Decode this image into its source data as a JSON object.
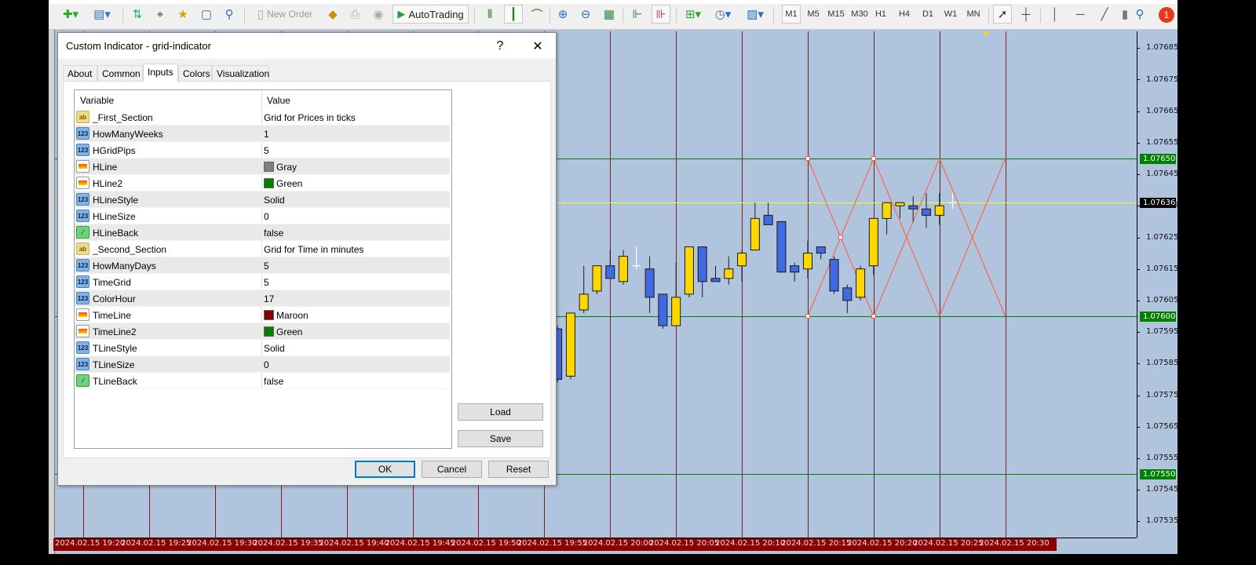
{
  "toolbar": {
    "new_order_label": "New Order",
    "autotrading_label": "AutoTrading",
    "timeframes": [
      "M1",
      "M5",
      "M15",
      "M30",
      "H1",
      "H4",
      "D1",
      "W1",
      "MN"
    ],
    "active_timeframe": "M1",
    "notification_count": "1"
  },
  "dialog": {
    "title": "Custom Indicator - grid-indicator",
    "help_label": "?",
    "close_label": "✕",
    "tabs": [
      "About",
      "Common",
      "Inputs",
      "Colors",
      "Visualization"
    ],
    "active_tab": "Inputs",
    "columns": {
      "variable": "Variable",
      "value": "Value"
    },
    "inputs": [
      {
        "type": "str",
        "name": "_First_Section",
        "value": "Grid for Prices in ticks"
      },
      {
        "type": "int",
        "name": "HowManyWeeks",
        "value": "1"
      },
      {
        "type": "int",
        "name": "HGridPips",
        "value": "5"
      },
      {
        "type": "color",
        "name": "HLine",
        "value": "Gray",
        "swatch": "#808080"
      },
      {
        "type": "color",
        "name": "HLine2",
        "value": "Green",
        "swatch": "#008000"
      },
      {
        "type": "int",
        "name": "HLineStyle",
        "value": "Solid"
      },
      {
        "type": "int",
        "name": "HLineSize",
        "value": "0"
      },
      {
        "type": "bool",
        "name": "HLineBack",
        "value": "false"
      },
      {
        "type": "str",
        "name": "_Second_Section",
        "value": "Grid for Time in minutes"
      },
      {
        "type": "int",
        "name": "HowManyDays",
        "value": "5"
      },
      {
        "type": "int",
        "name": "TimeGrid",
        "value": "5"
      },
      {
        "type": "int",
        "name": "ColorHour",
        "value": "17"
      },
      {
        "type": "color",
        "name": "TimeLine",
        "value": "Maroon",
        "swatch": "#800000"
      },
      {
        "type": "color",
        "name": "TimeLine2",
        "value": "Green",
        "swatch": "#008000"
      },
      {
        "type": "int",
        "name": "TLineStyle",
        "value": "Solid"
      },
      {
        "type": "int",
        "name": "TLineSize",
        "value": "0"
      },
      {
        "type": "bool",
        "name": "TLineBack",
        "value": "false"
      }
    ],
    "load_label": "Load",
    "save_label": "Save",
    "ok_label": "OK",
    "cancel_label": "Cancel",
    "reset_label": "Reset"
  },
  "chart_data": {
    "type": "candlestick",
    "date": "2024.02.15",
    "background": "#b0c4de",
    "bull_color": "#ffd700",
    "bear_color": "#4169e1",
    "time_labels": [
      "2024.02.15 19:20",
      "2024.02.15 19:25",
      "2024.02.15 19:30",
      "2024.02.15 19:35",
      "2024.02.15 19:40",
      "2024.02.15 19:45",
      "2024.02.15 19:50",
      "2024.02.15 19:55",
      "2024.02.15 20:00",
      "2024.02.15 20:05",
      "2024.02.15 20:10",
      "2024.02.15 20:15",
      "2024.02.15 20:20",
      "2024.02.15 20:25",
      "2024.02.15 20:30"
    ],
    "price_labels": [
      "1.07685",
      "1.07675",
      "1.07665",
      "1.07655",
      "1.07645",
      "1.07635",
      "1.07625",
      "1.07615",
      "1.07605",
      "1.07595",
      "1.07585",
      "1.07575",
      "1.07565",
      "1.07555",
      "1.07545",
      "1.07535"
    ],
    "ylim": [
      1.0753,
      1.0769
    ],
    "current_price": {
      "value": "1.07636",
      "color": "#ffff00"
    },
    "horizontal_grid": [
      {
        "value": "1.07650",
        "color": "#008000"
      },
      {
        "value": "1.07600",
        "color": "#008000"
      },
      {
        "value": "1.07550",
        "color": "#008000"
      }
    ],
    "vertical_grid": [
      "19:22",
      "19:27",
      "19:32",
      "19:37",
      "19:42",
      "19:47",
      "19:52",
      "19:57",
      "20:02",
      "20:07",
      "20:12",
      "20:17",
      "20:22",
      "20:27",
      "20:32"
    ],
    "vertical_grid_color": "#800000",
    "vertical_grid_dark": [
      "20:17",
      "20:22",
      "20:27"
    ],
    "cross_pattern": {
      "times": [
        "20:17",
        "20:22",
        "20:27",
        "20:32"
      ],
      "high": 1.0765,
      "low": 1.076,
      "color": "#ff5a3c"
    },
    "candles": [
      {
        "t": "19:58",
        "o": 1.07596,
        "h": 1.07597,
        "l": 1.07579,
        "c": 1.0758
      },
      {
        "t": "19:59",
        "o": 1.07581,
        "h": 1.07601,
        "l": 1.0758,
        "c": 1.07601
      },
      {
        "t": "20:00",
        "o": 1.07602,
        "h": 1.07616,
        "l": 1.07601,
        "c": 1.07607
      },
      {
        "t": "20:01",
        "o": 1.07608,
        "h": 1.07616,
        "l": 1.07607,
        "c": 1.07616
      },
      {
        "t": "20:02",
        "o": 1.07616,
        "h": 1.07621,
        "l": 1.07612,
        "c": 1.07612
      },
      {
        "t": "20:03",
        "o": 1.07611,
        "h": 1.07621,
        "l": 1.0761,
        "c": 1.07619
      },
      {
        "t": "20:04",
        "o": 1.07616,
        "h": 1.07622,
        "l": 1.07615,
        "c": 1.07616
      },
      {
        "t": "20:05",
        "o": 1.07615,
        "h": 1.07619,
        "l": 1.07601,
        "c": 1.07606
      },
      {
        "t": "20:06",
        "o": 1.07607,
        "h": 1.07607,
        "l": 1.07596,
        "c": 1.07597
      },
      {
        "t": "20:07",
        "o": 1.07597,
        "h": 1.07617,
        "l": 1.07597,
        "c": 1.07606
      },
      {
        "t": "20:08",
        "o": 1.07607,
        "h": 1.07622,
        "l": 1.07606,
        "c": 1.07622
      },
      {
        "t": "20:09",
        "o": 1.07622,
        "h": 1.07622,
        "l": 1.07606,
        "c": 1.07611
      },
      {
        "t": "20:10",
        "o": 1.07612,
        "h": 1.07616,
        "l": 1.07611,
        "c": 1.07611
      },
      {
        "t": "20:11",
        "o": 1.07612,
        "h": 1.07619,
        "l": 1.0761,
        "c": 1.07615
      },
      {
        "t": "20:12",
        "o": 1.07616,
        "h": 1.07621,
        "l": 1.07611,
        "c": 1.0762
      },
      {
        "t": "20:13",
        "o": 1.07621,
        "h": 1.07636,
        "l": 1.07621,
        "c": 1.07631
      },
      {
        "t": "20:14",
        "o": 1.07632,
        "h": 1.07636,
        "l": 1.07629,
        "c": 1.07629
      },
      {
        "t": "20:15",
        "o": 1.0763,
        "h": 1.0763,
        "l": 1.07614,
        "c": 1.07614
      },
      {
        "t": "20:16",
        "o": 1.07616,
        "h": 1.07617,
        "l": 1.07611,
        "c": 1.07614
      },
      {
        "t": "20:17",
        "o": 1.07615,
        "h": 1.07624,
        "l": 1.07612,
        "c": 1.0762
      },
      {
        "t": "20:18",
        "o": 1.07622,
        "h": 1.07622,
        "l": 1.07618,
        "c": 1.0762
      },
      {
        "t": "20:19",
        "o": 1.07618,
        "h": 1.07619,
        "l": 1.07607,
        "c": 1.07608
      },
      {
        "t": "20:20",
        "o": 1.07609,
        "h": 1.0761,
        "l": 1.07601,
        "c": 1.07605
      },
      {
        "t": "20:21",
        "o": 1.07606,
        "h": 1.07616,
        "l": 1.07605,
        "c": 1.07615
      },
      {
        "t": "20:22",
        "o": 1.07616,
        "h": 1.07631,
        "l": 1.07613,
        "c": 1.07631
      },
      {
        "t": "20:23",
        "o": 1.07631,
        "h": 1.07636,
        "l": 1.07626,
        "c": 1.07636
      },
      {
        "t": "20:24",
        "o": 1.07635,
        "h": 1.07636,
        "l": 1.07631,
        "c": 1.07636
      },
      {
        "t": "20:25",
        "o": 1.07635,
        "h": 1.07638,
        "l": 1.0763,
        "c": 1.07634
      },
      {
        "t": "20:26",
        "o": 1.07634,
        "h": 1.07639,
        "l": 1.07628,
        "c": 1.07632
      },
      {
        "t": "20:27",
        "o": 1.07632,
        "h": 1.07639,
        "l": 1.07629,
        "c": 1.07635
      },
      {
        "t": "20:28",
        "o": 1.07636,
        "h": 1.07639,
        "l": 1.07634,
        "c": 1.07636
      }
    ]
  }
}
